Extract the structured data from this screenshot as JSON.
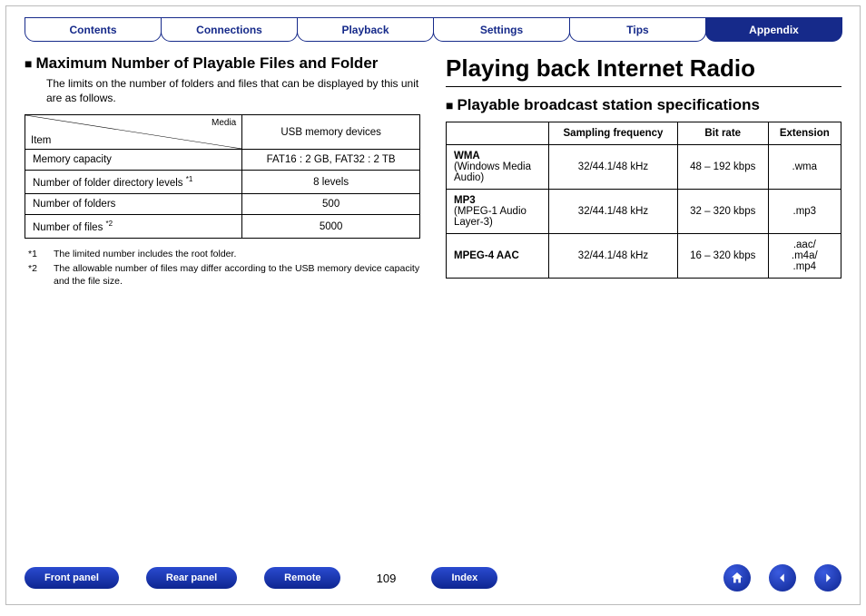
{
  "tabs": {
    "items": [
      {
        "label": "Contents"
      },
      {
        "label": "Connections"
      },
      {
        "label": "Playback"
      },
      {
        "label": "Settings"
      },
      {
        "label": "Tips"
      },
      {
        "label": "Appendix"
      }
    ],
    "active_index": 5
  },
  "left": {
    "heading": "Maximum Number of Playable Files and Folder",
    "lead": "The limits on the number of folders and files that can be displayed by this unit are as follows.",
    "table": {
      "media_label": "Media",
      "item_label": "Item",
      "col_header": "USB memory devices",
      "rows": [
        {
          "item": "Memory capacity",
          "note": "",
          "value": "FAT16 : 2 GB, FAT32 : 2 TB"
        },
        {
          "item": "Number of folder directory levels",
          "note": "*1",
          "value": "8 levels"
        },
        {
          "item": "Number of folders",
          "note": "",
          "value": "500"
        },
        {
          "item": "Number of files",
          "note": "*2",
          "value": "5000"
        }
      ]
    },
    "footnotes": [
      {
        "mark": "*1",
        "text": "The limited number includes the root folder."
      },
      {
        "mark": "*2",
        "text": "The allowable number of files may differ according to the USB memory device capacity and the file size."
      }
    ]
  },
  "right": {
    "title": "Playing back Internet Radio",
    "heading": "Playable broadcast station specifications",
    "table": {
      "headers": [
        "",
        "Sampling frequency",
        "Bit rate",
        "Extension"
      ],
      "rows": [
        {
          "name": "WMA",
          "sub": "(Windows Media Audio)",
          "freq": "32/44.1/48 kHz",
          "bitrate": "48 – 192 kbps",
          "ext": ".wma"
        },
        {
          "name": "MP3",
          "sub": "(MPEG-1 Audio Layer-3)",
          "freq": "32/44.1/48 kHz",
          "bitrate": "32 – 320 kbps",
          "ext": ".mp3"
        },
        {
          "name": "MPEG-4 AAC",
          "sub": "",
          "freq": "32/44.1/48 kHz",
          "bitrate": "16 – 320 kbps",
          "ext": ".aac/\n.m4a/\n.mp4"
        }
      ]
    }
  },
  "bottom": {
    "pills": [
      {
        "label": "Front panel"
      },
      {
        "label": "Rear panel"
      },
      {
        "label": "Remote"
      }
    ],
    "page": "109",
    "index_label": "Index"
  }
}
